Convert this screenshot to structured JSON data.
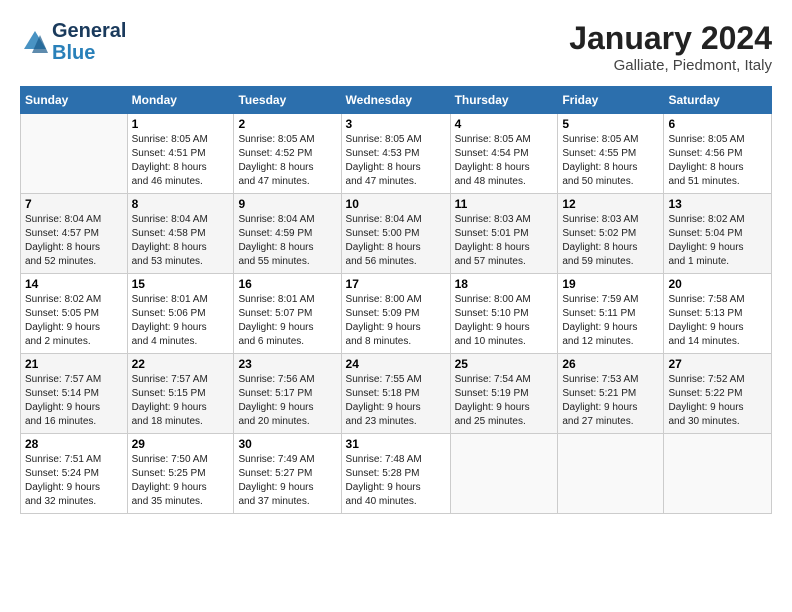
{
  "header": {
    "logo_line1": "General",
    "logo_line2": "Blue",
    "month_title": "January 2024",
    "subtitle": "Galliate, Piedmont, Italy"
  },
  "weekdays": [
    "Sunday",
    "Monday",
    "Tuesday",
    "Wednesday",
    "Thursday",
    "Friday",
    "Saturday"
  ],
  "weeks": [
    [
      {
        "day": "",
        "info": ""
      },
      {
        "day": "1",
        "info": "Sunrise: 8:05 AM\nSunset: 4:51 PM\nDaylight: 8 hours\nand 46 minutes."
      },
      {
        "day": "2",
        "info": "Sunrise: 8:05 AM\nSunset: 4:52 PM\nDaylight: 8 hours\nand 47 minutes."
      },
      {
        "day": "3",
        "info": "Sunrise: 8:05 AM\nSunset: 4:53 PM\nDaylight: 8 hours\nand 47 minutes."
      },
      {
        "day": "4",
        "info": "Sunrise: 8:05 AM\nSunset: 4:54 PM\nDaylight: 8 hours\nand 48 minutes."
      },
      {
        "day": "5",
        "info": "Sunrise: 8:05 AM\nSunset: 4:55 PM\nDaylight: 8 hours\nand 50 minutes."
      },
      {
        "day": "6",
        "info": "Sunrise: 8:05 AM\nSunset: 4:56 PM\nDaylight: 8 hours\nand 51 minutes."
      }
    ],
    [
      {
        "day": "7",
        "info": "Sunrise: 8:04 AM\nSunset: 4:57 PM\nDaylight: 8 hours\nand 52 minutes."
      },
      {
        "day": "8",
        "info": "Sunrise: 8:04 AM\nSunset: 4:58 PM\nDaylight: 8 hours\nand 53 minutes."
      },
      {
        "day": "9",
        "info": "Sunrise: 8:04 AM\nSunset: 4:59 PM\nDaylight: 8 hours\nand 55 minutes."
      },
      {
        "day": "10",
        "info": "Sunrise: 8:04 AM\nSunset: 5:00 PM\nDaylight: 8 hours\nand 56 minutes."
      },
      {
        "day": "11",
        "info": "Sunrise: 8:03 AM\nSunset: 5:01 PM\nDaylight: 8 hours\nand 57 minutes."
      },
      {
        "day": "12",
        "info": "Sunrise: 8:03 AM\nSunset: 5:02 PM\nDaylight: 8 hours\nand 59 minutes."
      },
      {
        "day": "13",
        "info": "Sunrise: 8:02 AM\nSunset: 5:04 PM\nDaylight: 9 hours\nand 1 minute."
      }
    ],
    [
      {
        "day": "14",
        "info": "Sunrise: 8:02 AM\nSunset: 5:05 PM\nDaylight: 9 hours\nand 2 minutes."
      },
      {
        "day": "15",
        "info": "Sunrise: 8:01 AM\nSunset: 5:06 PM\nDaylight: 9 hours\nand 4 minutes."
      },
      {
        "day": "16",
        "info": "Sunrise: 8:01 AM\nSunset: 5:07 PM\nDaylight: 9 hours\nand 6 minutes."
      },
      {
        "day": "17",
        "info": "Sunrise: 8:00 AM\nSunset: 5:09 PM\nDaylight: 9 hours\nand 8 minutes."
      },
      {
        "day": "18",
        "info": "Sunrise: 8:00 AM\nSunset: 5:10 PM\nDaylight: 9 hours\nand 10 minutes."
      },
      {
        "day": "19",
        "info": "Sunrise: 7:59 AM\nSunset: 5:11 PM\nDaylight: 9 hours\nand 12 minutes."
      },
      {
        "day": "20",
        "info": "Sunrise: 7:58 AM\nSunset: 5:13 PM\nDaylight: 9 hours\nand 14 minutes."
      }
    ],
    [
      {
        "day": "21",
        "info": "Sunrise: 7:57 AM\nSunset: 5:14 PM\nDaylight: 9 hours\nand 16 minutes."
      },
      {
        "day": "22",
        "info": "Sunrise: 7:57 AM\nSunset: 5:15 PM\nDaylight: 9 hours\nand 18 minutes."
      },
      {
        "day": "23",
        "info": "Sunrise: 7:56 AM\nSunset: 5:17 PM\nDaylight: 9 hours\nand 20 minutes."
      },
      {
        "day": "24",
        "info": "Sunrise: 7:55 AM\nSunset: 5:18 PM\nDaylight: 9 hours\nand 23 minutes."
      },
      {
        "day": "25",
        "info": "Sunrise: 7:54 AM\nSunset: 5:19 PM\nDaylight: 9 hours\nand 25 minutes."
      },
      {
        "day": "26",
        "info": "Sunrise: 7:53 AM\nSunset: 5:21 PM\nDaylight: 9 hours\nand 27 minutes."
      },
      {
        "day": "27",
        "info": "Sunrise: 7:52 AM\nSunset: 5:22 PM\nDaylight: 9 hours\nand 30 minutes."
      }
    ],
    [
      {
        "day": "28",
        "info": "Sunrise: 7:51 AM\nSunset: 5:24 PM\nDaylight: 9 hours\nand 32 minutes."
      },
      {
        "day": "29",
        "info": "Sunrise: 7:50 AM\nSunset: 5:25 PM\nDaylight: 9 hours\nand 35 minutes."
      },
      {
        "day": "30",
        "info": "Sunrise: 7:49 AM\nSunset: 5:27 PM\nDaylight: 9 hours\nand 37 minutes."
      },
      {
        "day": "31",
        "info": "Sunrise: 7:48 AM\nSunset: 5:28 PM\nDaylight: 9 hours\nand 40 minutes."
      },
      {
        "day": "",
        "info": ""
      },
      {
        "day": "",
        "info": ""
      },
      {
        "day": "",
        "info": ""
      }
    ]
  ]
}
